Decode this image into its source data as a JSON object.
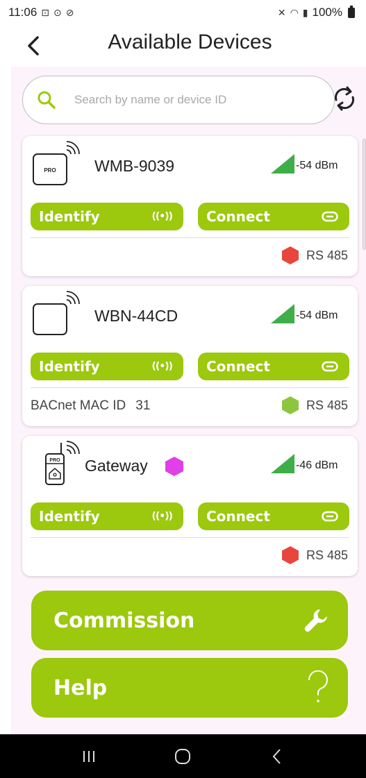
{
  "status_bar": {
    "time": "11:06",
    "battery": "100%"
  },
  "header": {
    "title": "Available Devices"
  },
  "search": {
    "placeholder": "Search by name or device ID"
  },
  "devices": [
    {
      "name": "WMB-9039",
      "signal": "-54 dBm",
      "identify_label": "Identify",
      "connect_label": "Connect",
      "bacnet_label": "",
      "bacnet_value": "",
      "protocol": "RS 485",
      "protocol_status_color": "#e8453c",
      "icon": "pro-device-icon"
    },
    {
      "name": "WBN-44CD",
      "signal": "-54 dBm",
      "identify_label": "Identify",
      "connect_label": "Connect",
      "bacnet_label": "BACnet MAC ID",
      "bacnet_value": "31",
      "protocol": "RS 485",
      "protocol_status_color": "#8cc63f",
      "icon": "blank-device-icon"
    },
    {
      "name": "Gateway",
      "signal": "-46 dBm",
      "identify_label": "Identify",
      "connect_label": "Connect",
      "bacnet_label": "",
      "bacnet_value": "",
      "protocol": "RS 485",
      "protocol_status_color": "#e8453c",
      "name_badge_color": "#e040e6",
      "icon": "gateway-device-icon"
    }
  ],
  "actions": {
    "commission_label": "Commission",
    "help_label": "Help"
  },
  "colors": {
    "accent": "#9cc80e",
    "signal": "#3fae49",
    "panel_bg": "#fdf3fb"
  }
}
